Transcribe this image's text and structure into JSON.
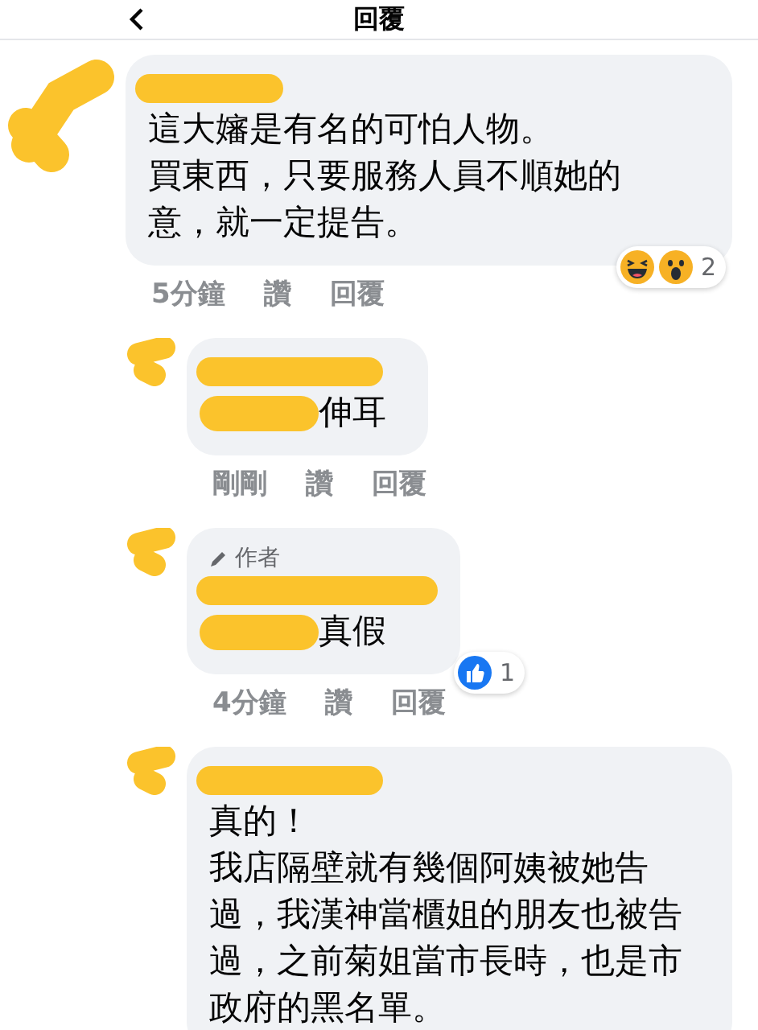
{
  "header": {
    "title": "回覆"
  },
  "comments": [
    {
      "kind": "comment",
      "paragraphs": [
        "這大嬸是有名的可怕人物。",
        "買東西，只要服務人員不順她的意，就一定提告。"
      ],
      "time": "5分鐘",
      "like": "讚",
      "reply": "回覆",
      "reactions": [
        {
          "kind": "haha"
        },
        {
          "kind": "wow"
        }
      ],
      "reaction_count": "2"
    },
    {
      "kind": "reply",
      "hidden_prefix": true,
      "paragraphs": [
        "伸耳"
      ],
      "time": "剛剛",
      "like": "讚",
      "reply": "回覆"
    },
    {
      "kind": "reply",
      "author_badge": "作者",
      "hidden_prefix": true,
      "paragraphs": [
        "真假"
      ],
      "time": "4分鐘",
      "like": "讚",
      "reply": "回覆",
      "reactions": [
        {
          "kind": "like"
        }
      ],
      "reaction_count": "1"
    },
    {
      "kind": "reply",
      "hidden_prefix": false,
      "paragraphs": [
        "真的！",
        "我店隔壁就有幾個阿姨被她告過，我漢神當櫃姐的朋友也被告過，之前菊姐當市長時，也是市政府的黑名單。"
      ]
    }
  ]
}
